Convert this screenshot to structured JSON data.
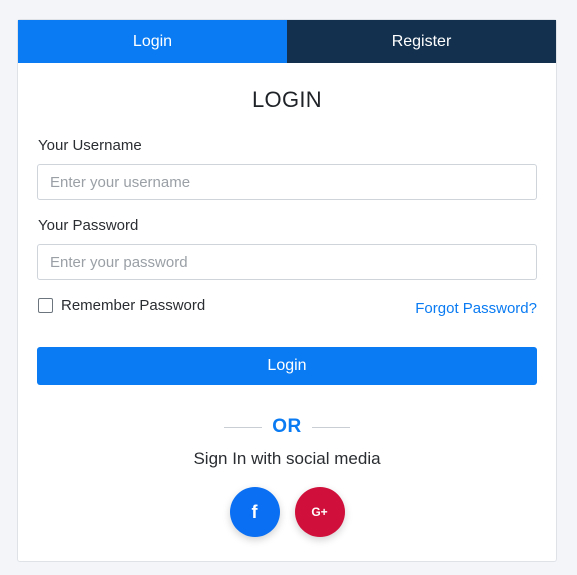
{
  "tabs": [
    {
      "label": "Login",
      "color": "#0a7bf2"
    },
    {
      "label": "Register",
      "color": "#13314f"
    }
  ],
  "form": {
    "title": "LOGIN",
    "username_label": "Your Username",
    "username_placeholder": "Enter your username",
    "username_value": "",
    "password_label": "Your Password",
    "password_placeholder": "Enter your password",
    "password_value": "",
    "remember_label": "Remember Password",
    "remember_checked": false,
    "forgot_label": "Forgot Password?",
    "submit_label": "Login"
  },
  "social": {
    "or_text": "OR",
    "caption": "Sign In with social media",
    "buttons": [
      {
        "icon": "facebook-icon",
        "glyph": "f",
        "color": "#0a6ff2"
      },
      {
        "icon": "google-plus-icon",
        "glyph": "G+",
        "color": "#d0103a"
      }
    ]
  },
  "colors": {
    "accent": "#0a7bf2",
    "dark": "#13314f"
  }
}
